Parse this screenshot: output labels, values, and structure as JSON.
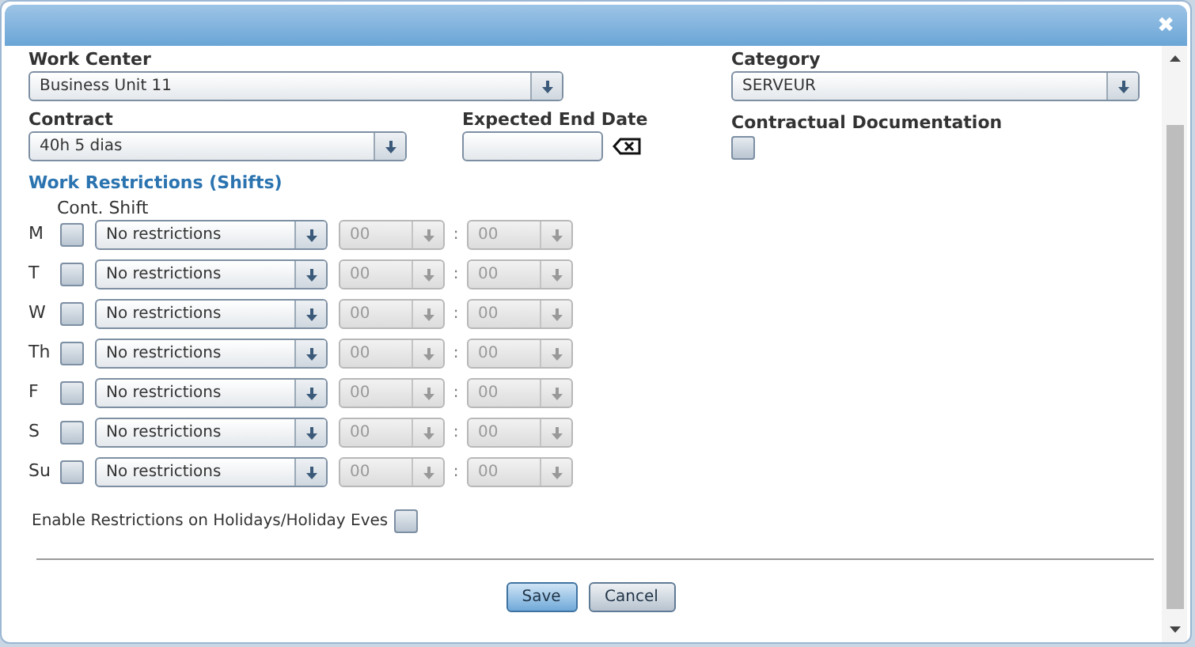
{
  "dialog": {
    "close_button": "✖"
  },
  "work_center": {
    "label": "Work Center",
    "value": "Business Unit 11"
  },
  "category": {
    "label": "Category",
    "value": "SERVEUR"
  },
  "contract": {
    "label": "Contract",
    "value": "40h 5 dias"
  },
  "expected_end_date": {
    "label": "Expected End Date"
  },
  "contractual_documentation": {
    "label": "Contractual Documentation",
    "checked": false
  },
  "restrictions": {
    "title": "Work Restrictions (Shifts)",
    "column_label": "Cont. Shift",
    "time_separator": ":",
    "rows": [
      {
        "day": "M",
        "checked": false,
        "shift": "No restrictions",
        "hour": "00",
        "minute": "00",
        "time_disabled": true
      },
      {
        "day": "T",
        "checked": false,
        "shift": "No restrictions",
        "hour": "00",
        "minute": "00",
        "time_disabled": true
      },
      {
        "day": "W",
        "checked": false,
        "shift": "No restrictions",
        "hour": "00",
        "minute": "00",
        "time_disabled": true
      },
      {
        "day": "Th",
        "checked": false,
        "shift": "No restrictions",
        "hour": "00",
        "minute": "00",
        "time_disabled": true
      },
      {
        "day": "F",
        "checked": false,
        "shift": "No restrictions",
        "hour": "00",
        "minute": "00",
        "time_disabled": true
      },
      {
        "day": "S",
        "checked": false,
        "shift": "No restrictions",
        "hour": "00",
        "minute": "00",
        "time_disabled": true
      },
      {
        "day": "Su",
        "checked": false,
        "shift": "No restrictions",
        "hour": "00",
        "minute": "00",
        "time_disabled": true
      }
    ]
  },
  "holidays": {
    "label": "Enable Restrictions on Holidays/Holiday Eves",
    "checked": false
  },
  "buttons": [
    {
      "label": "Save",
      "kind": "primary"
    },
    {
      "label": "Cancel",
      "kind": "secondary"
    }
  ]
}
